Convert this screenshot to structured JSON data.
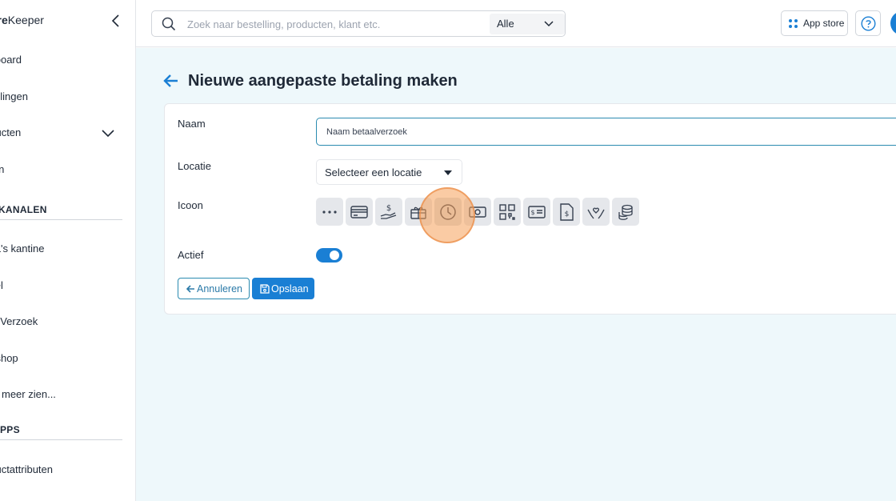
{
  "app": {
    "logo_bold": "ore",
    "logo_rest": "Keeper"
  },
  "sidebar": {
    "items": [
      {
        "label": "shboard"
      },
      {
        "label": "stellingen"
      },
      {
        "label": "oducten"
      },
      {
        "label": "nten"
      },
      {
        "label": "cha's kantine"
      },
      {
        "label": "nkel"
      },
      {
        "label": "stelVerzoek"
      },
      {
        "label": "ebshop"
      },
      {
        "label": "meer zien..."
      },
      {
        "label": "oductattributen"
      }
    ],
    "sections": [
      {
        "label": "OPKANALEN"
      },
      {
        "label": "PPS"
      }
    ]
  },
  "topbar": {
    "search_placeholder": "Zoek naar bestelling, producten, klant etc.",
    "scope_value": "Alle",
    "appstore_label": "App store"
  },
  "page": {
    "title": "Nieuwe aangepaste betaling maken",
    "form": {
      "name_label": "Naam",
      "name_value": "Naam betaalverzoek",
      "location_label": "Locatie",
      "location_value": "Selecteer een locatie",
      "icon_label": "Icoon",
      "icons": [
        "dots-icon",
        "credit-card-icon",
        "hand-coin-icon",
        "gift-card-icon",
        "clock-icon",
        "banknote-icon",
        "qr-code-icon",
        "id-card-icon",
        "invoice-dollar-icon",
        "hands-heart-icon",
        "coins-stack-icon"
      ],
      "selected_icon": "clock-icon",
      "active_label": "Actief",
      "active": true,
      "cancel_label": "Annuleren",
      "save_label": "Opslaan"
    }
  },
  "colors": {
    "primary": "#1a7fd4",
    "background": "#eef8fb",
    "outline": "#2b8bb0",
    "click_highlight": "#f5a05a"
  }
}
